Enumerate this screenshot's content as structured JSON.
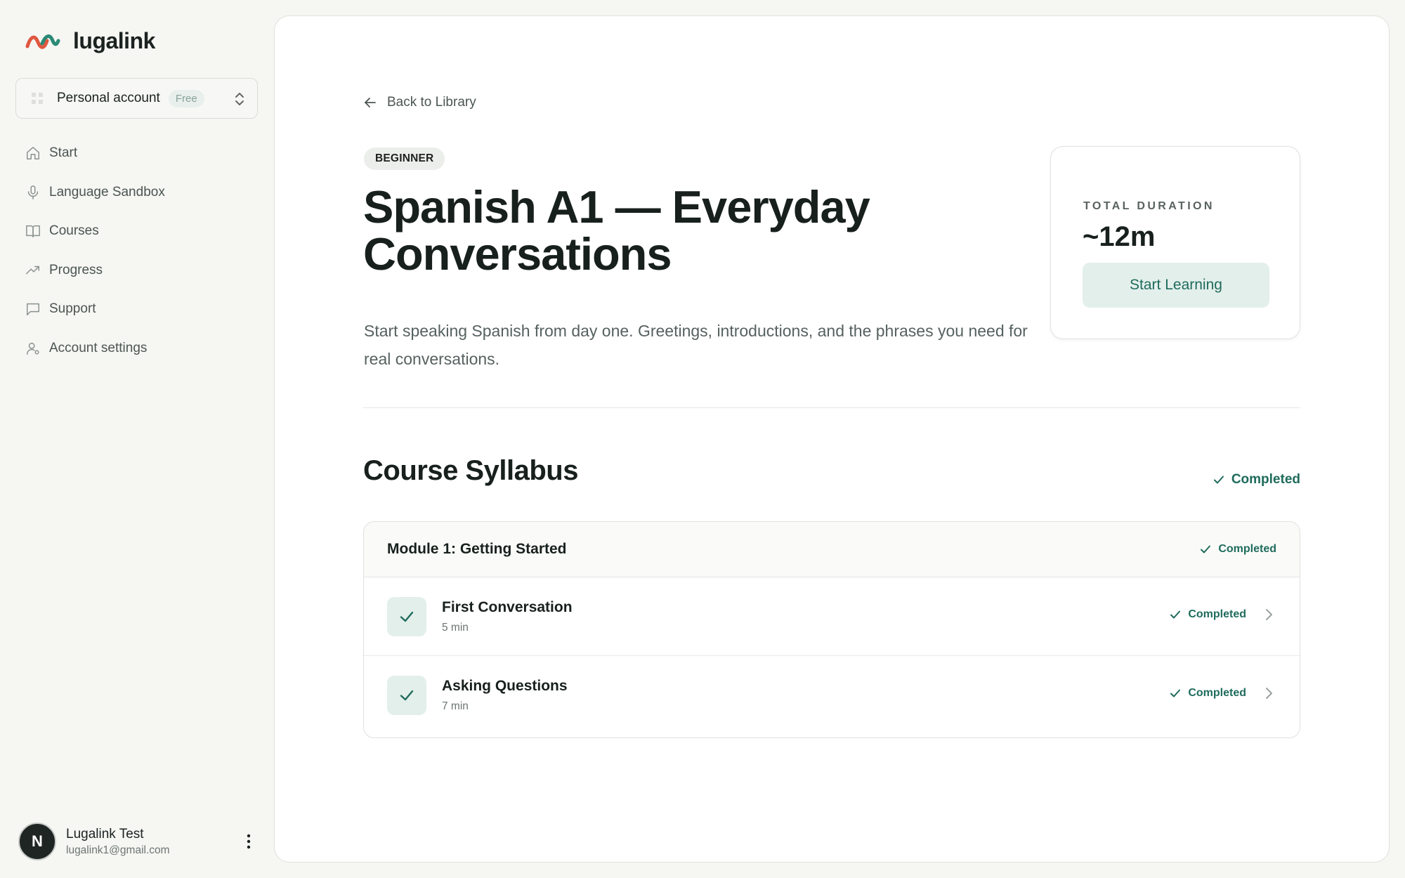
{
  "brand": {
    "name": "lugalink"
  },
  "account": {
    "name": "Personal account",
    "plan": "Free"
  },
  "nav": [
    {
      "label": "Start",
      "icon": "home-icon"
    },
    {
      "label": "Language Sandbox",
      "icon": "microphone-icon"
    },
    {
      "label": "Courses",
      "icon": "book-icon"
    },
    {
      "label": "Progress",
      "icon": "trending-up-icon"
    },
    {
      "label": "Support",
      "icon": "chat-icon"
    },
    {
      "label": "Account settings",
      "icon": "user-gear-icon"
    }
  ],
  "user": {
    "initial": "N",
    "name": "Lugalink Test",
    "email": "lugalink1@gmail.com"
  },
  "course": {
    "back_label": "Back to Library",
    "level": "BEGINNER",
    "title": "Spanish A1 — Everyday Conversations",
    "description": "Start speaking Spanish from day one. Greetings, introductions, and the phrases you need for real conversations.",
    "duration_label": "TOTAL DURATION",
    "duration_value": "~12m",
    "start_label": "Start Learning"
  },
  "syllabus": {
    "title": "Course Syllabus",
    "status": "Completed",
    "modules": [
      {
        "title": "Module 1: Getting Started",
        "status": "Completed",
        "lessons": [
          {
            "title": "First Conversation",
            "duration": "5 min",
            "status": "Completed"
          },
          {
            "title": "Asking Questions",
            "duration": "7 min",
            "status": "Completed"
          }
        ]
      }
    ]
  },
  "colors": {
    "accent": "#1f6b5c",
    "accent_bg": "#e3efeb",
    "logo_red": "#e0573f",
    "logo_teal": "#2a8a76"
  }
}
